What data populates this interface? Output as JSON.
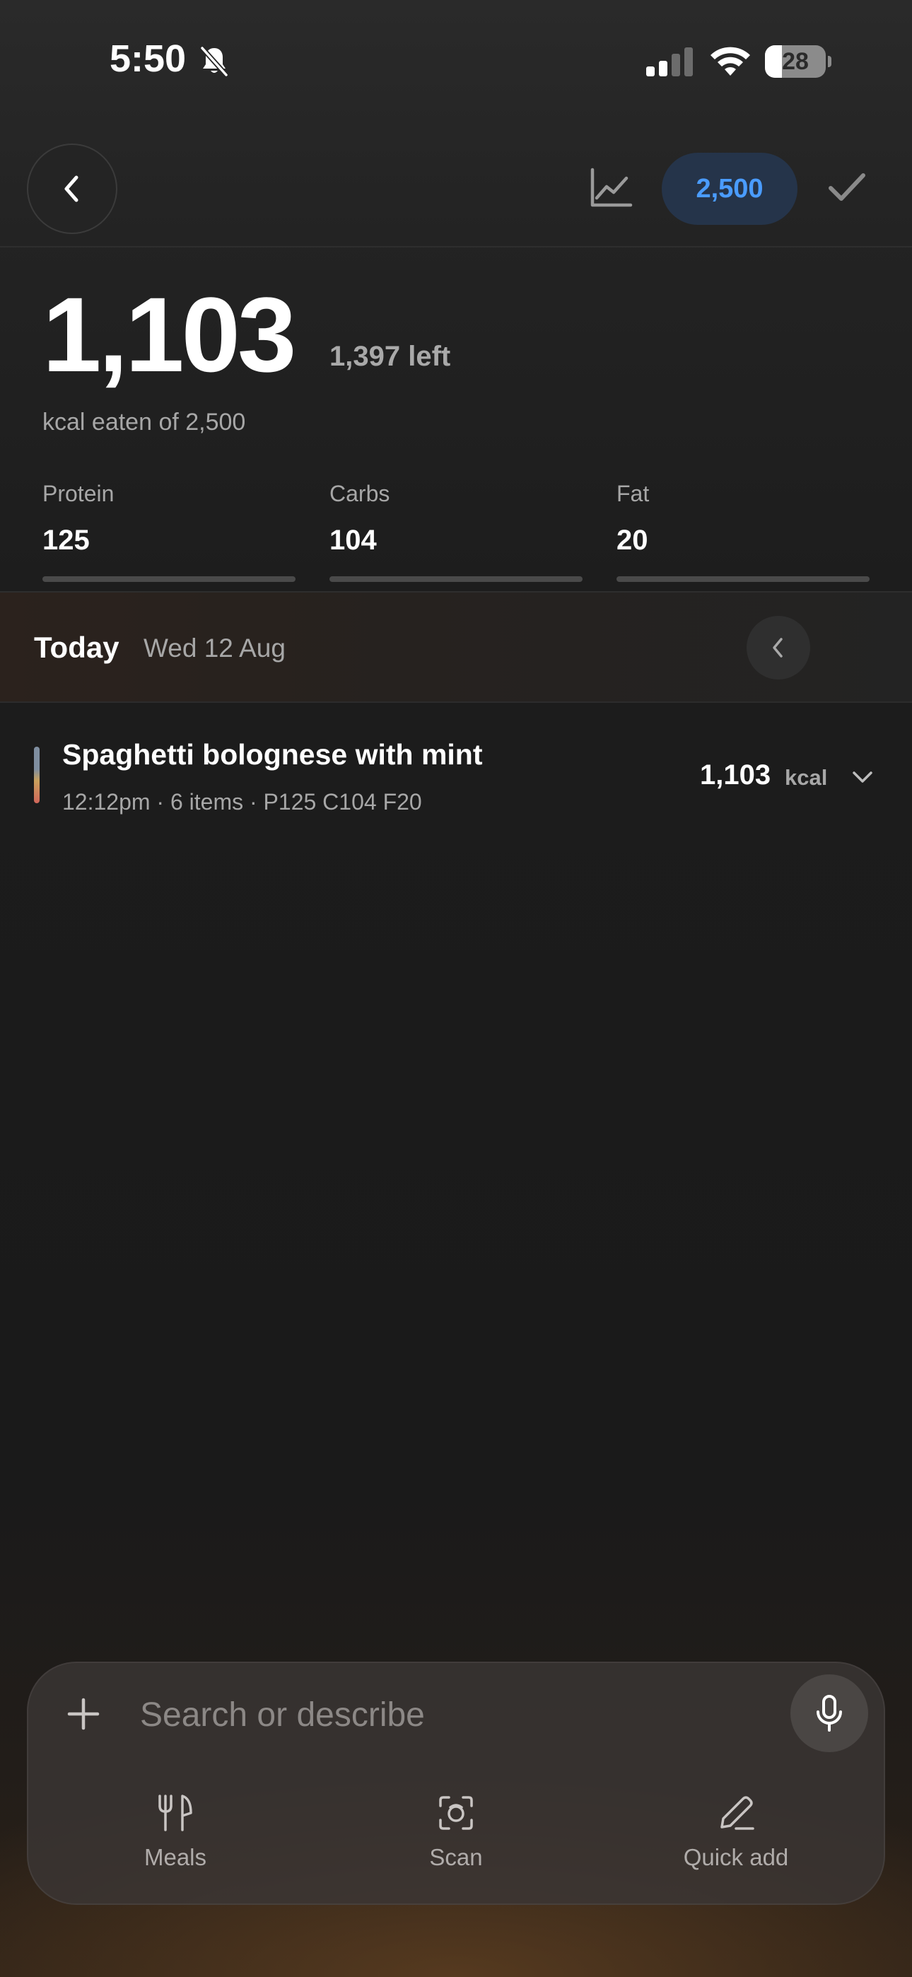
{
  "status_bar": {
    "time": "5:50",
    "battery_level": "28",
    "battery_fraction": 0.28,
    "icons": [
      "bell-slash-icon",
      "cellular-signal-icon",
      "wifi-icon",
      "battery-icon"
    ]
  },
  "header": {
    "back_icon": "chevron-left-icon",
    "chart_icon": "line-chart-icon",
    "goal_value": "2,500",
    "confirm_icon": "checkmark-icon",
    "accent_color": "#4a9cff"
  },
  "summary": {
    "kcal_eaten": "1,103",
    "kcal_left": "1,397 left",
    "kcal_caption": "kcal eaten of 2,500",
    "macros": [
      {
        "label": "Protein",
        "value": "125"
      },
      {
        "label": "Carbs",
        "value": "104"
      },
      {
        "label": "Fat",
        "value": "20"
      }
    ]
  },
  "day": {
    "title": "Today",
    "date": "Wed 12 Aug",
    "prev_icon": "chevron-left-icon"
  },
  "meals": [
    {
      "title": "Spaghetti bolognese with mint",
      "meta": "12:12pm · 6 items · P125 C104 F20",
      "kcal": "1,103",
      "kcal_unit": "kcal",
      "expand_icon": "chevron-down-icon"
    }
  ],
  "composer": {
    "add_icon": "plus-icon",
    "placeholder": "Search or describe",
    "mic_icon": "microphone-icon",
    "actions": [
      {
        "label": "Meals",
        "icon": "fork-knife-icon"
      },
      {
        "label": "Scan",
        "icon": "scan-icon"
      },
      {
        "label": "Quick add",
        "icon": "pencil-icon"
      }
    ]
  }
}
